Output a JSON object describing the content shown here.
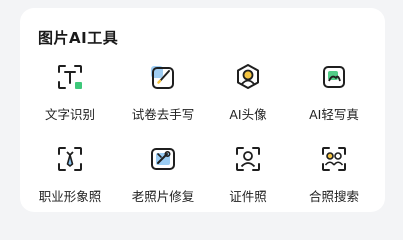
{
  "section": {
    "title": "图片AI工具"
  },
  "tools": [
    {
      "label": "文字识别",
      "icon": "text-recognition-icon"
    },
    {
      "label": "试卷去手写",
      "icon": "edit-paper-icon"
    },
    {
      "label": "AI头像",
      "icon": "ai-avatar-icon"
    },
    {
      "label": "AI轻写真",
      "icon": "ai-portrait-icon"
    },
    {
      "label": "职业形象照",
      "icon": "professional-photo-icon"
    },
    {
      "label": "老照片修复",
      "icon": "photo-repair-icon"
    },
    {
      "label": "证件照",
      "icon": "id-photo-icon"
    },
    {
      "label": "合照搜索",
      "icon": "group-photo-search-icon"
    }
  ],
  "colors": {
    "accent_yellow": "#f5c542",
    "accent_blue": "#8fc6f2",
    "accent_green": "#3ec87a",
    "icon_stroke": "#1f1f1f"
  }
}
